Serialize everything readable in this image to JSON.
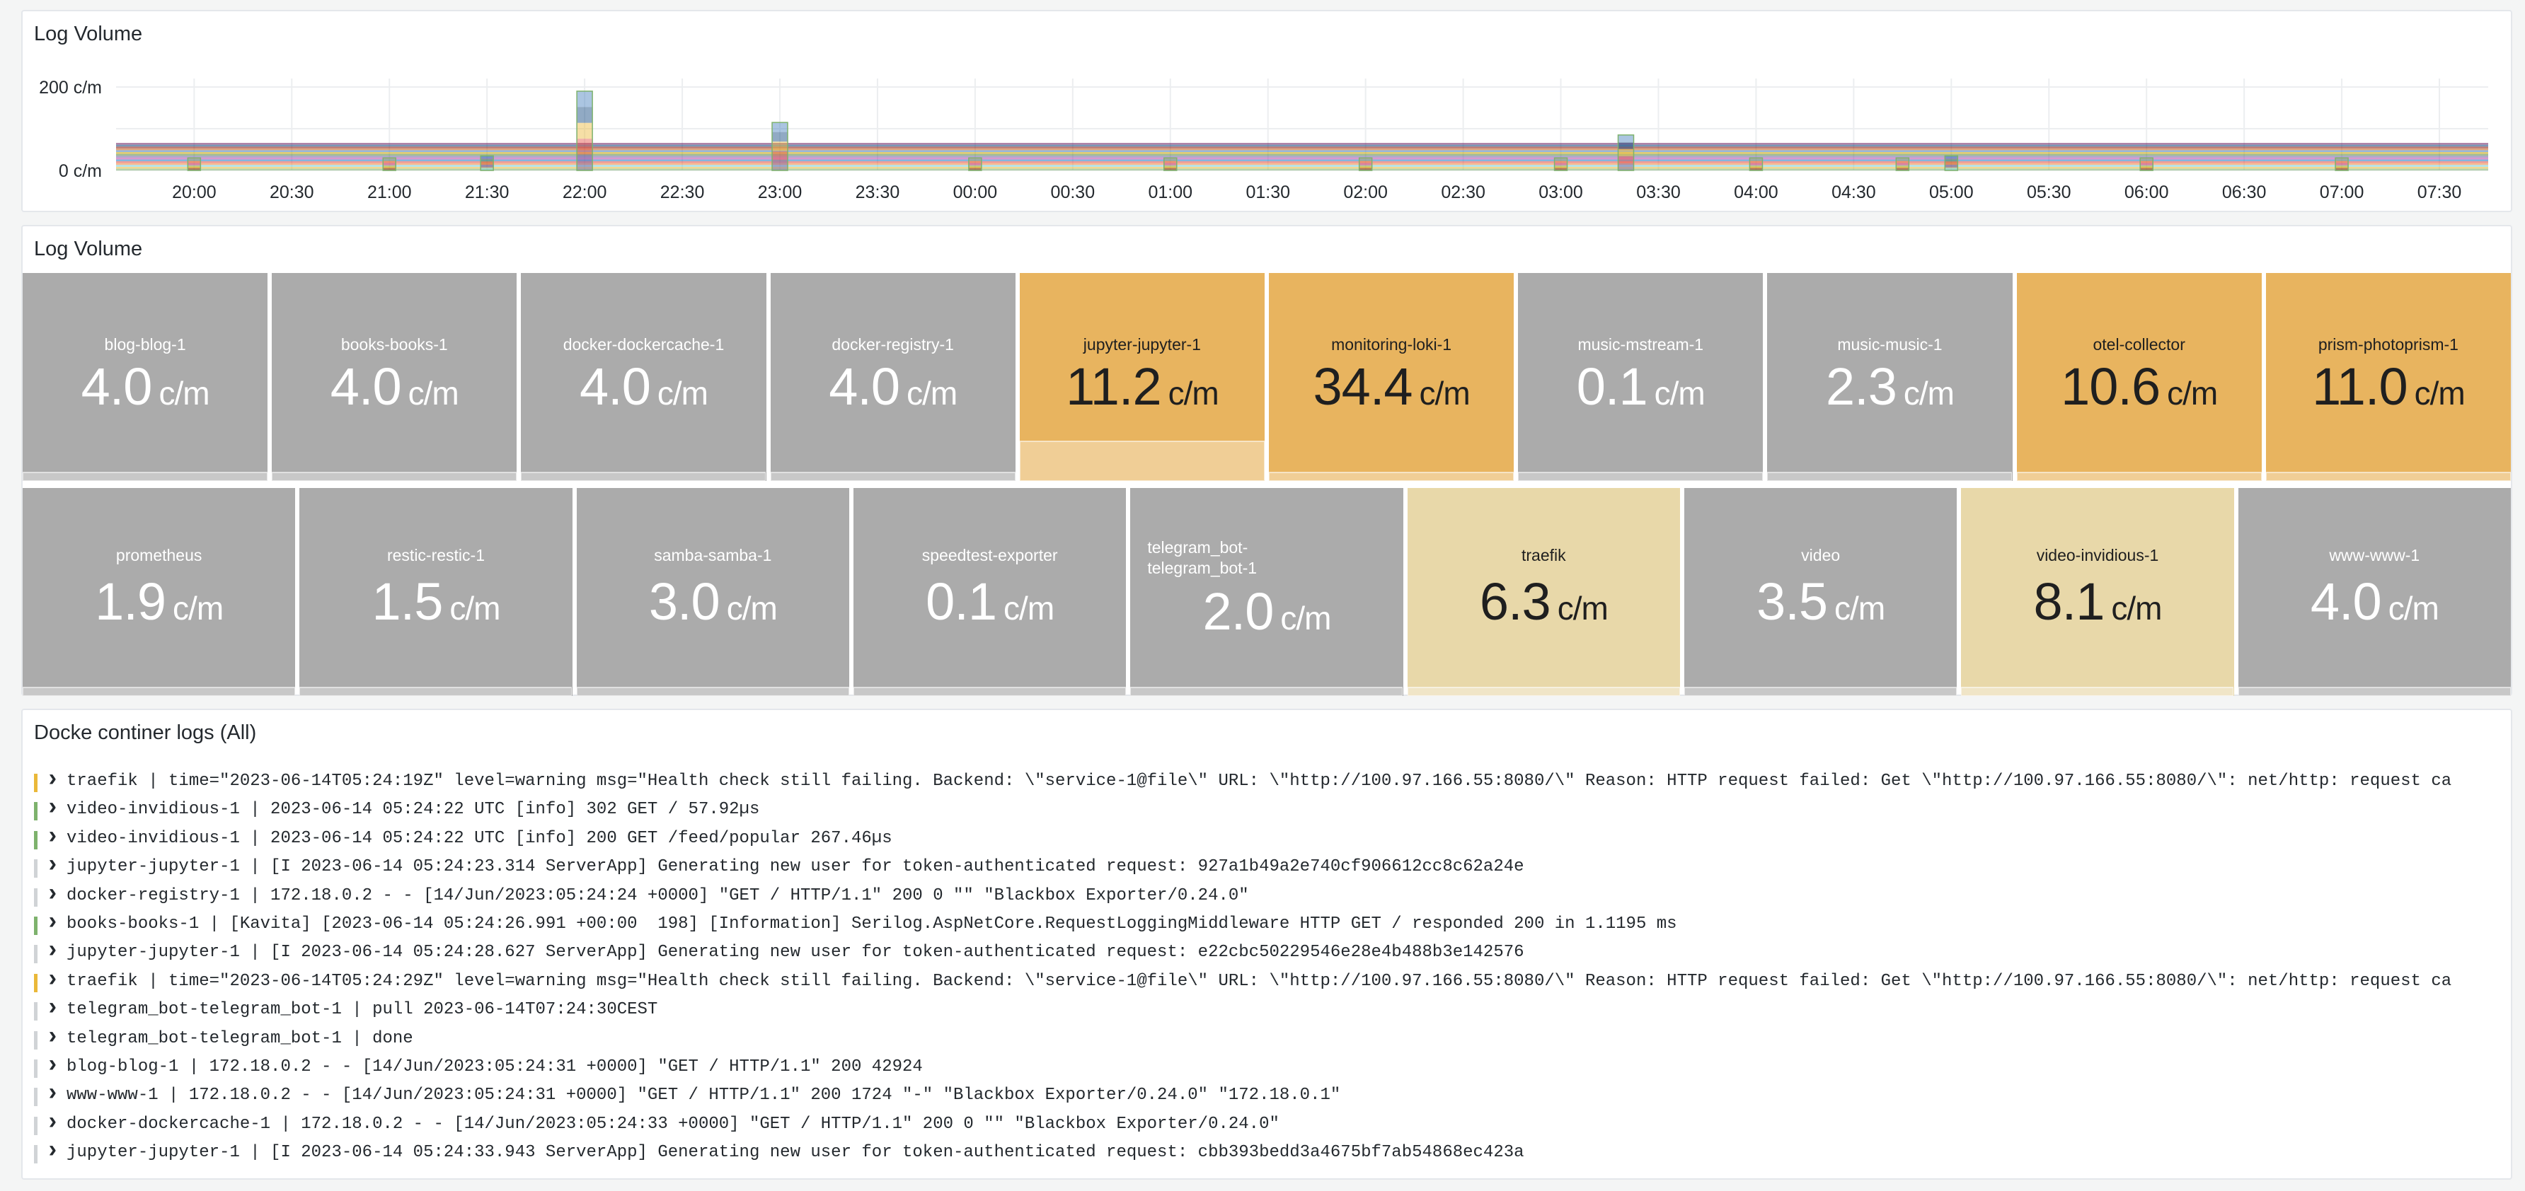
{
  "panels": {
    "log_volume_chart_title": "Log Volume",
    "stat_panel_title": "Log Volume",
    "logs_title": "Docke continer logs (All)"
  },
  "chart_data": {
    "type": "area",
    "stacked": true,
    "title": "Log Volume",
    "y_ticks": [
      "200 c/m",
      "0 c/m"
    ],
    "ylim": [
      0,
      200
    ],
    "x_ticks": [
      "20:00",
      "20:30",
      "21:00",
      "21:30",
      "22:00",
      "22:30",
      "23:00",
      "23:30",
      "00:00",
      "00:30",
      "01:00",
      "01:30",
      "02:00",
      "02:30",
      "03:00",
      "03:30",
      "04:00",
      "04:30",
      "05:00",
      "05:30",
      "06:00",
      "06:30",
      "07:00",
      "07:30"
    ],
    "grid": true,
    "colors": [
      "#7eb26d",
      "#eab839",
      "#6ed0e0",
      "#ef843c",
      "#e24d42",
      "#1f78c1",
      "#ba43a9",
      "#705da0",
      "#508642",
      "#cca300",
      "#447ebc",
      "#c15c17",
      "#890f02",
      "#0a437c",
      "#6d1f62"
    ],
    "spikes": [
      {
        "time": "20:00",
        "value": 30
      },
      {
        "time": "21:00",
        "value": 30
      },
      {
        "time": "21:30",
        "value": 35
      },
      {
        "time": "22:00",
        "value": 190
      },
      {
        "time": "23:00",
        "value": 115
      },
      {
        "time": "00:00",
        "value": 30
      },
      {
        "time": "01:00",
        "value": 30
      },
      {
        "time": "02:00",
        "value": 30
      },
      {
        "time": "03:00",
        "value": 30
      },
      {
        "time": "03:20",
        "value": 85
      },
      {
        "time": "04:00",
        "value": 30
      },
      {
        "time": "04:45",
        "value": 30
      },
      {
        "time": "05:00",
        "value": 35
      },
      {
        "time": "06:00",
        "value": 30
      },
      {
        "time": "07:00",
        "value": 30
      }
    ]
  },
  "stat_colors": {
    "gray": "#ababab",
    "orange": "#e8b45f",
    "light": "#e8d8a9"
  },
  "stats_row1": [
    {
      "label": "blog-blog-1",
      "value": "4.0",
      "unit": "c/m",
      "color": "gray"
    },
    {
      "label": "books-books-1",
      "value": "4.0",
      "unit": "c/m",
      "color": "gray"
    },
    {
      "label": "docker-dockercache-1",
      "value": "4.0",
      "unit": "c/m",
      "color": "gray"
    },
    {
      "label": "docker-registry-1",
      "value": "4.0",
      "unit": "c/m",
      "color": "gray"
    },
    {
      "label": "jupyter-jupyter-1",
      "value": "11.2",
      "unit": "c/m",
      "color": "orange"
    },
    {
      "label": "monitoring-loki-1",
      "value": "34.4",
      "unit": "c/m",
      "color": "orange"
    },
    {
      "label": "music-mstream-1",
      "value": "0.1",
      "unit": "c/m",
      "color": "gray"
    },
    {
      "label": "music-music-1",
      "value": "2.3",
      "unit": "c/m",
      "color": "gray"
    },
    {
      "label": "otel-collector",
      "value": "10.6",
      "unit": "c/m",
      "color": "orange"
    },
    {
      "label": "prism-photoprism-1",
      "value": "11.0",
      "unit": "c/m",
      "color": "orange"
    }
  ],
  "stats_row2": [
    {
      "label": "prometheus",
      "value": "1.9",
      "unit": "c/m",
      "color": "gray"
    },
    {
      "label": "restic-restic-1",
      "value": "1.5",
      "unit": "c/m",
      "color": "gray"
    },
    {
      "label": "samba-samba-1",
      "value": "3.0",
      "unit": "c/m",
      "color": "gray"
    },
    {
      "label": "speedtest-exporter",
      "value": "0.1",
      "unit": "c/m",
      "color": "gray"
    },
    {
      "label": "telegram_bot-telegram_bot-1",
      "label_lines": [
        "telegram_bot-",
        "telegram_bot-1"
      ],
      "value": "2.0",
      "unit": "c/m",
      "color": "gray"
    },
    {
      "label": "traefik",
      "value": "6.3",
      "unit": "c/m",
      "color": "light"
    },
    {
      "label": "video",
      "value": "3.5",
      "unit": "c/m",
      "color": "gray"
    },
    {
      "label": "video-invidious-1",
      "value": "8.1",
      "unit": "c/m",
      "color": "light"
    },
    {
      "label": "www-www-1",
      "value": "4.0",
      "unit": "c/m",
      "color": "gray"
    }
  ],
  "log_level_colors": {
    "warning": "#eab839",
    "info": "#7eb26d",
    "unknown": "#d0d3d6"
  },
  "logs": [
    {
      "level": "warning",
      "text": "traefik | time=\"2023-06-14T05:24:19Z\" level=warning msg=\"Health check still failing. Backend: \\\"service-1@file\\\" URL: \\\"http://100.97.166.55:8080/\\\" Reason: HTTP request failed: Get \\\"http://100.97.166.55:8080/\\\": net/http: request ca"
    },
    {
      "level": "info",
      "text": "video-invidious-1 | 2023-06-14 05:24:22 UTC [info] 302 GET / 57.92µs"
    },
    {
      "level": "info",
      "text": "video-invidious-1 | 2023-06-14 05:24:22 UTC [info] 200 GET /feed/popular 267.46µs"
    },
    {
      "level": "unknown",
      "text": "jupyter-jupyter-1 | [I 2023-06-14 05:24:23.314 ServerApp] Generating new user for token-authenticated request: 927a1b49a2e740cf906612cc8c62a24e"
    },
    {
      "level": "unknown",
      "text": "docker-registry-1 | 172.18.0.2 - - [14/Jun/2023:05:24:24 +0000] \"GET / HTTP/1.1\" 200 0 \"\" \"Blackbox Exporter/0.24.0\""
    },
    {
      "level": "info",
      "text": "books-books-1 | [Kavita] [2023-06-14 05:24:26.991 +00:00  198] [Information] Serilog.AspNetCore.RequestLoggingMiddleware HTTP GET / responded 200 in 1.1195 ms"
    },
    {
      "level": "unknown",
      "text": "jupyter-jupyter-1 | [I 2023-06-14 05:24:28.627 ServerApp] Generating new user for token-authenticated request: e22cbc50229546e28e4b488b3e142576"
    },
    {
      "level": "warning",
      "text": "traefik | time=\"2023-06-14T05:24:29Z\" level=warning msg=\"Health check still failing. Backend: \\\"service-1@file\\\" URL: \\\"http://100.97.166.55:8080/\\\" Reason: HTTP request failed: Get \\\"http://100.97.166.55:8080/\\\": net/http: request ca"
    },
    {
      "level": "unknown",
      "text": "telegram_bot-telegram_bot-1 | pull 2023-06-14T07:24:30CEST"
    },
    {
      "level": "unknown",
      "text": "telegram_bot-telegram_bot-1 | done"
    },
    {
      "level": "unknown",
      "text": "blog-blog-1 | 172.18.0.2 - - [14/Jun/2023:05:24:31 +0000] \"GET / HTTP/1.1\" 200 42924"
    },
    {
      "level": "unknown",
      "text": "www-www-1 | 172.18.0.2 - - [14/Jun/2023:05:24:31 +0000] \"GET / HTTP/1.1\" 200 1724 \"-\" \"Blackbox Exporter/0.24.0\" \"172.18.0.1\""
    },
    {
      "level": "unknown",
      "text": "docker-dockercache-1 | 172.18.0.2 - - [14/Jun/2023:05:24:33 +0000] \"GET / HTTP/1.1\" 200 0 \"\" \"Blackbox Exporter/0.24.0\""
    },
    {
      "level": "unknown",
      "text": "jupyter-jupyter-1 | [I 2023-06-14 05:24:33.943 ServerApp] Generating new user for token-authenticated request: cbb393bedd3a4675bf7ab54868ec423a"
    }
  ]
}
